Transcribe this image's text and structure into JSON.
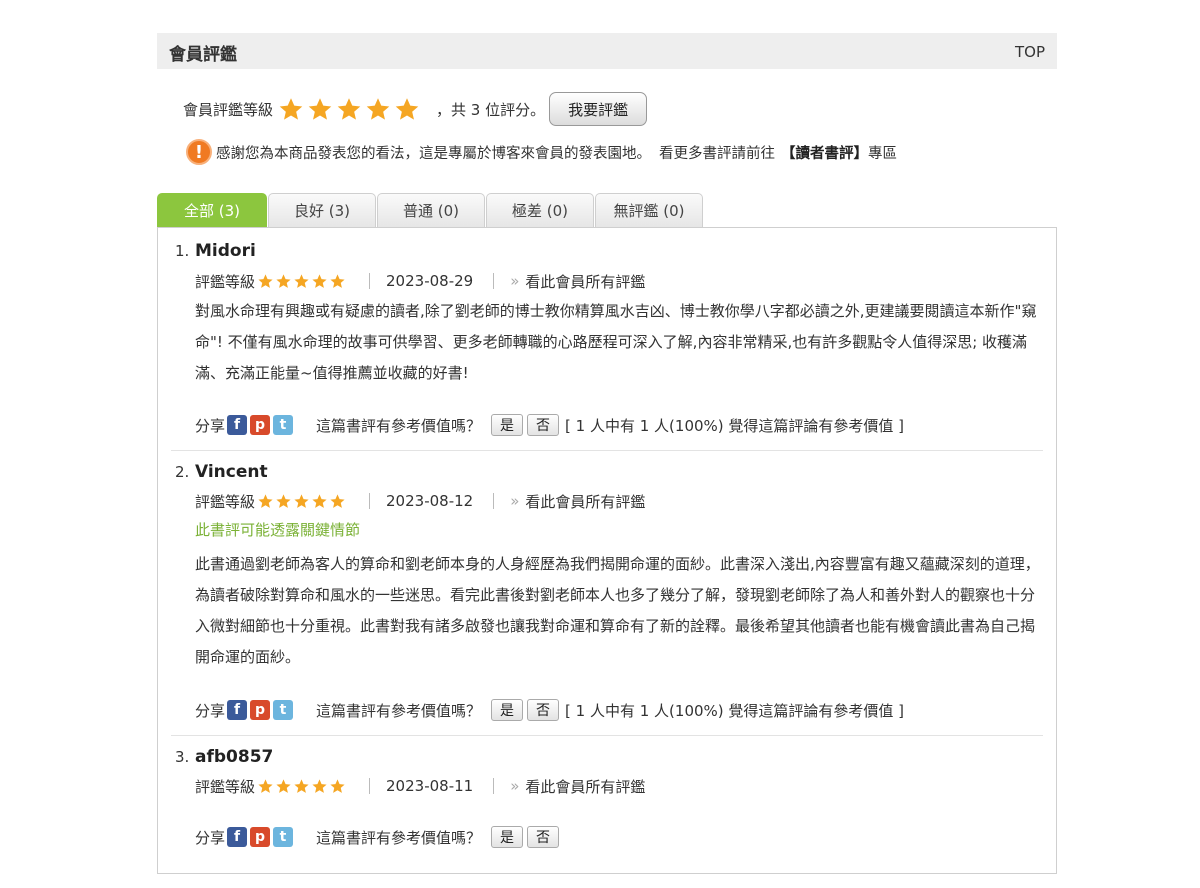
{
  "header": {
    "title": "會員評鑑",
    "top_link": "TOP"
  },
  "summary": {
    "rating_label": "會員評鑑等級",
    "rating_stars": 5,
    "rating_max": 5,
    "count_text": "，共 3 位評分。",
    "review_button": "我要評鑑"
  },
  "notice": {
    "text": "感謝您為本商品發表您的看法，這是專屬於博客來會員的發表園地。",
    "more_text": "看更多書評請前往",
    "link_text": "【讀者書評】",
    "tail_text": "專區"
  },
  "tabs": [
    {
      "label": "全部 (3)",
      "active": true
    },
    {
      "label": "良好 (3)",
      "active": false
    },
    {
      "label": "普通 (0)",
      "active": false
    },
    {
      "label": "極差 (0)",
      "active": false
    },
    {
      "label": "無評鑑 (0)",
      "active": false
    }
  ],
  "common": {
    "meta_label": "評鑑等級",
    "view_all": "看此會員所有評鑑",
    "raquo": "»",
    "share_label": "分享",
    "question": "這篇書評有參考價值嗎？",
    "yes": "是",
    "no": "否"
  },
  "colors": {
    "accent_green": "#8cc63e",
    "star_orange": "#f5a623",
    "warn_orange": "#f07a22",
    "spoiler_green": "#7ab135"
  },
  "reviews": [
    {
      "num": "1.",
      "name": "Midori",
      "stars": 5,
      "date": "2023-08-29",
      "spoiler": "",
      "body": "對風水命理有興趣或有疑慮的讀者,除了劉老師的博士教你精算風水吉凶、博士教你學八字都必讀之外,更建議要閱讀這本新作\"窺命\"! 不僅有風水命理的故事可供學習、更多老師轉職的心路歷程可深入了解,內容非常精采,也有許多觀點令人值得深思; 收穫滿滿、充滿正能量~值得推薦並收藏的好書!",
      "vote_result": "[ 1 人中有 1 人(100%) 覺得這篇評論有參考價值 ]"
    },
    {
      "num": "2.",
      "name": "Vincent",
      "stars": 5,
      "date": "2023-08-12",
      "spoiler": "此書評可能透露關鍵情節",
      "body": "此書通過劉老師為客人的算命和劉老師本身的人身經歷為我們揭開命運的面紗。此書深入淺出,內容豐富有趣又蘊藏深刻的道理，為讀者破除對算命和風水的一些迷思。看完此書後對劉老師本人也多了幾分了解，發現劉老師除了為人和善外對人的觀察也十分入微對細節也十分重視。此書對我有諸多啟發也讓我對命運和算命有了新的詮釋。最後希望其他讀者也能有機會讀此書為自己揭開命運的面紗。",
      "vote_result": "[ 1 人中有 1 人(100%) 覺得這篇評論有參考價值 ]"
    },
    {
      "num": "3.",
      "name": "afb0857",
      "stars": 5,
      "date": "2023-08-11",
      "spoiler": "",
      "body": "",
      "vote_result": ""
    }
  ]
}
